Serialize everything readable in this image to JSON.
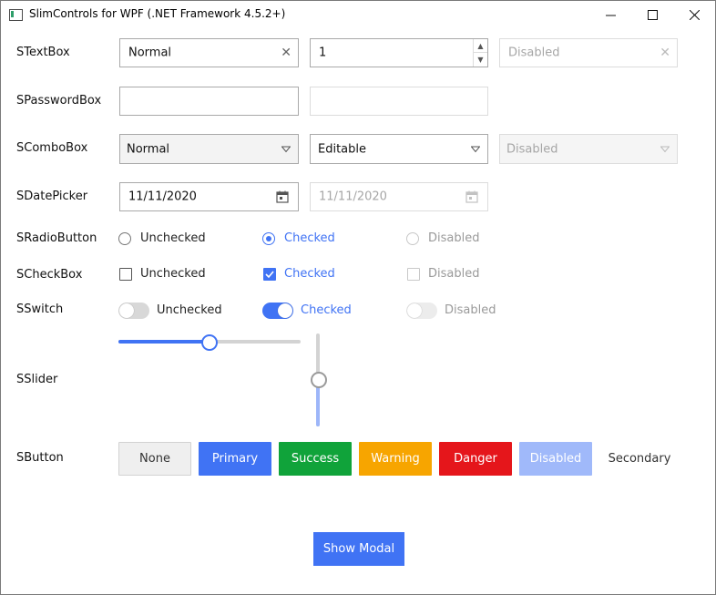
{
  "window": {
    "title": "SlimControls for WPF (.NET Framework 4.5.2+)",
    "icons": {
      "minimize": "minimize-icon",
      "maximize": "maximize-icon",
      "close": "close-icon",
      "app": "app-icon"
    }
  },
  "labels": {
    "textbox": "STextBox",
    "password": "SPasswordBox",
    "combobox": "SComboBox",
    "datepicker": "SDatePicker",
    "radio": "SRadioButton",
    "checkbox": "SCheckBox",
    "switch": "SSwitch",
    "slider": "SSlider",
    "button": "SButton"
  },
  "textbox": {
    "normal": "Normal",
    "numeric": "1",
    "disabled": "Disabled",
    "clear_glyph": "✕"
  },
  "password": {
    "first": "",
    "second": ""
  },
  "combobox": {
    "normal": "Normal",
    "editable": "Editable",
    "disabled": "Disabled"
  },
  "datepicker": {
    "first": "11/11/2020",
    "second": "11/11/2020"
  },
  "radio": {
    "unchecked": "Unchecked",
    "checked": "Checked",
    "disabled": "Disabled"
  },
  "checkbox": {
    "unchecked": "Unchecked",
    "checked": "Checked",
    "disabled": "Disabled"
  },
  "switch": {
    "unchecked": "Unchecked",
    "checked": "Checked",
    "disabled": "Disabled"
  },
  "slider": {
    "horizontal_value": 0.5,
    "vertical_value": 0.5
  },
  "buttons": {
    "none": "None",
    "primary": "Primary",
    "success": "Success",
    "warning": "Warning",
    "danger": "Danger",
    "disabled": "Disabled",
    "secondary": "Secondary"
  },
  "modal_button": "Show Modal",
  "colors": {
    "accent": "#4073f4",
    "success": "#10a33a",
    "warning": "#f7a500",
    "danger": "#e5161b",
    "disabled_accent": "#a0b9fa"
  }
}
